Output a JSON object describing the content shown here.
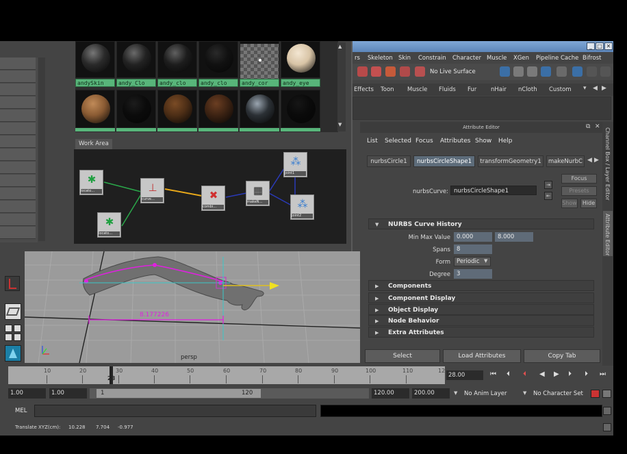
{
  "menubar": {
    "items": [
      "rs",
      "Skeleton",
      "Skin",
      "Constrain",
      "Character",
      "Muscle",
      "XGen",
      "Pipeline Cache",
      "Bifrost"
    ]
  },
  "toolbar": {
    "no_live_surface": "No Live Surface"
  },
  "shelf": {
    "tabs": [
      "Effects",
      "Toon",
      "Muscle",
      "Fluids",
      "Fur",
      "nHair",
      "nCloth",
      "Custom"
    ]
  },
  "hypershade": {
    "materials": [
      {
        "label": "andySkin",
        "color": "#2a2a2a",
        "shine": "#777777"
      },
      {
        "label": "andy_Clo",
        "color": "#222222",
        "shine": "#6a6a6a"
      },
      {
        "label": "andy_clo",
        "color": "#1d1d1d",
        "shine": "#606060"
      },
      {
        "label": "andy_clo",
        "color": "#111111",
        "shine": "#2a2a2a"
      },
      {
        "label": "andy_cor",
        "color": "checker",
        "shine": "#ffffff"
      },
      {
        "label": "andy_eye",
        "color": "#d8c4a6",
        "shine": "#f3e6d2"
      },
      {
        "label": "",
        "color": "#8a5b33",
        "shine": "#c08a58"
      },
      {
        "label": "",
        "color": "#0b0b0b",
        "shine": "#1c1c1c"
      },
      {
        "label": "",
        "color": "#4d2e16",
        "shine": "#7a4b25"
      },
      {
        "label": "",
        "color": "#3d2313",
        "shine": "#6b3e22"
      },
      {
        "label": "",
        "color": "#2b3035",
        "shine": "#9aa5b0"
      },
      {
        "label": "",
        "color": "#0a0a0a",
        "shine": "#161616"
      }
    ],
    "work_area_label": "Work Area",
    "nodes": [
      {
        "id": "locator1",
        "label": "locato…"
      },
      {
        "id": "locator2",
        "label": "locato…"
      },
      {
        "id": "curve",
        "label": "curve…"
      },
      {
        "id": "combine",
        "label": "combi…"
      },
      {
        "id": "makenurbs",
        "label": "makeN…"
      },
      {
        "id": "joint1",
        "label": "joint1"
      },
      {
        "id": "joint2",
        "label": "joint2"
      }
    ]
  },
  "viewport": {
    "measure_value": "8.177226",
    "camera_label": "persp"
  },
  "attribute_editor": {
    "title": "Attribute Editor",
    "menu": [
      "List",
      "Selected",
      "Focus",
      "Attributes",
      "Show",
      "Help"
    ],
    "tabs": [
      "nurbsCircle1",
      "nurbsCircleShape1",
      "transformGeometry1",
      "makeNurbC"
    ],
    "active_tab": "nurbsCircleShape1",
    "node_label": "nurbsCurve:",
    "node_value": "nurbsCircleShape1",
    "focus_btn": "Focus",
    "presets_btn": "Presets",
    "show_btn": "Show",
    "hide_btn": "Hide",
    "history_section": "NURBS Curve History",
    "min_max_label": "Min Max Value",
    "min_value": "0.000",
    "max_value": "8.000",
    "spans_label": "Spans",
    "spans_value": "8",
    "form_label": "Form",
    "form_value": "Periodic",
    "degree_label": "Degree",
    "degree_value": "3",
    "sections": [
      "Components",
      "Component Display",
      "Object Display",
      "Node Behavior",
      "Extra Attributes"
    ],
    "select_btn": "Select",
    "load_btn": "Load Attributes",
    "copy_btn": "Copy Tab",
    "channel_box_label": "Channel Box / Layer Editor",
    "ae_side_label": "Attribute Editor"
  },
  "timeline": {
    "ticks": [
      "10",
      "20",
      "30",
      "40",
      "50",
      "60",
      "70",
      "80",
      "90",
      "100",
      "110",
      "12"
    ],
    "playhead_label": "28",
    "current_time": "28.00"
  },
  "range": {
    "start_outer": "1.00",
    "start_inner": "1.00",
    "slider_start": "1",
    "slider_end": "120",
    "end_inner": "120.00",
    "end_outer": "200.00",
    "anim_layer": "No Anim Layer",
    "char_set": "No Character Set"
  },
  "command": {
    "mel_label": "MEL"
  },
  "helpline": {
    "text": "Translate XYZ(cm):",
    "x": "10.228",
    "y": "7.704",
    "z": "-0.977"
  }
}
